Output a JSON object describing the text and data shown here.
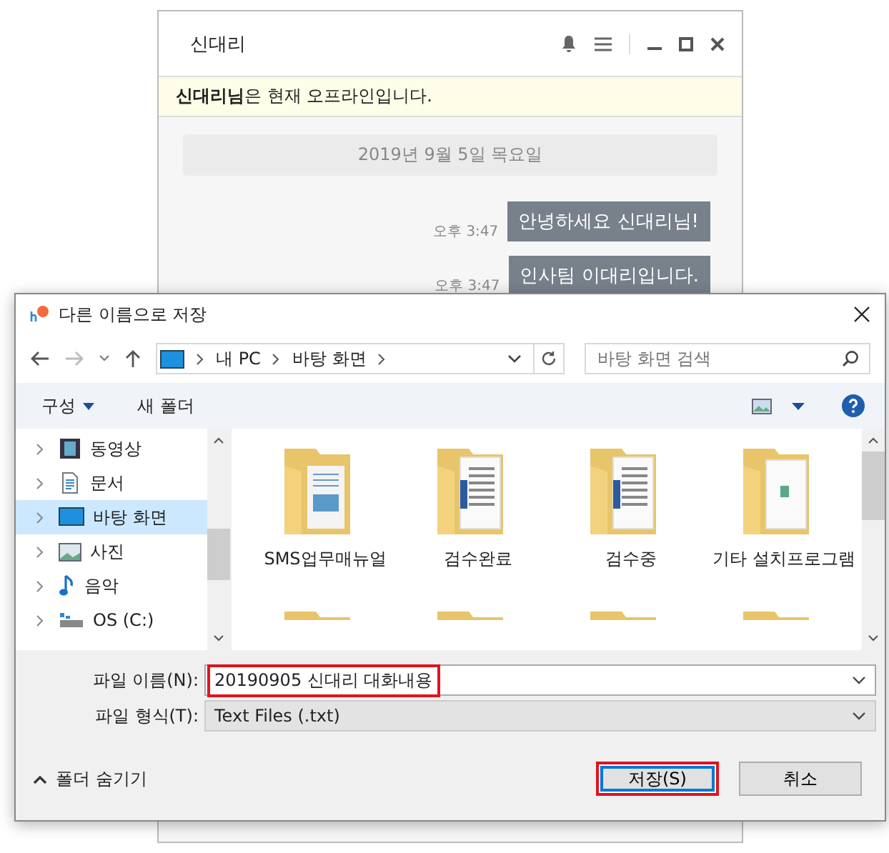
{
  "chat": {
    "title": "신대리",
    "status_notice": "**신대리님**은 현재 오프라인입니다.",
    "date": "2019년 9월 5일 목요일",
    "messages": [
      {
        "time": "오후 3:47",
        "text": "안녕하세요 신대리님!"
      },
      {
        "time": "오후 3:47",
        "text": "인사팀 이대리입니다."
      }
    ]
  },
  "dialog": {
    "title": "다른 이름으로 저장",
    "breadcrumb": [
      "내 PC",
      "바탕 화면"
    ],
    "search": {
      "placeholder": "바탕 화면 검색"
    },
    "toolbar": {
      "organize": "구성",
      "new_folder": "새 폴더"
    },
    "sidebar": {
      "items": [
        {
          "label": "동영상",
          "kind": "video",
          "selected": false
        },
        {
          "label": "문서",
          "kind": "document",
          "selected": false
        },
        {
          "label": "바탕 화면",
          "kind": "desktop",
          "selected": true
        },
        {
          "label": "사진",
          "kind": "picture",
          "selected": false
        },
        {
          "label": "음악",
          "kind": "music",
          "selected": false
        },
        {
          "label": "OS (C:)",
          "kind": "drive",
          "selected": false
        }
      ]
    },
    "folders": [
      {
        "name": "SMS업무매뉴얼",
        "kind": "picture"
      },
      {
        "name": "검수완료",
        "kind": "document"
      },
      {
        "name": "검수중",
        "kind": "document"
      },
      {
        "name": "기타 설치프로그램",
        "kind": "app"
      }
    ],
    "file_name": {
      "label": "파일 이름(N):",
      "value": "20190905 신대리 대화내용",
      "highlighted": true
    },
    "file_type": {
      "label": "파일 형식(T):",
      "value": "Text Files (.txt)"
    },
    "hide_folders": "폴더 숨기기",
    "buttons": [
      {
        "label": "저장(S)",
        "kind": "primary",
        "highlighted": true
      },
      {
        "label": "취소",
        "kind": "cancel",
        "highlighted": false
      }
    ]
  }
}
